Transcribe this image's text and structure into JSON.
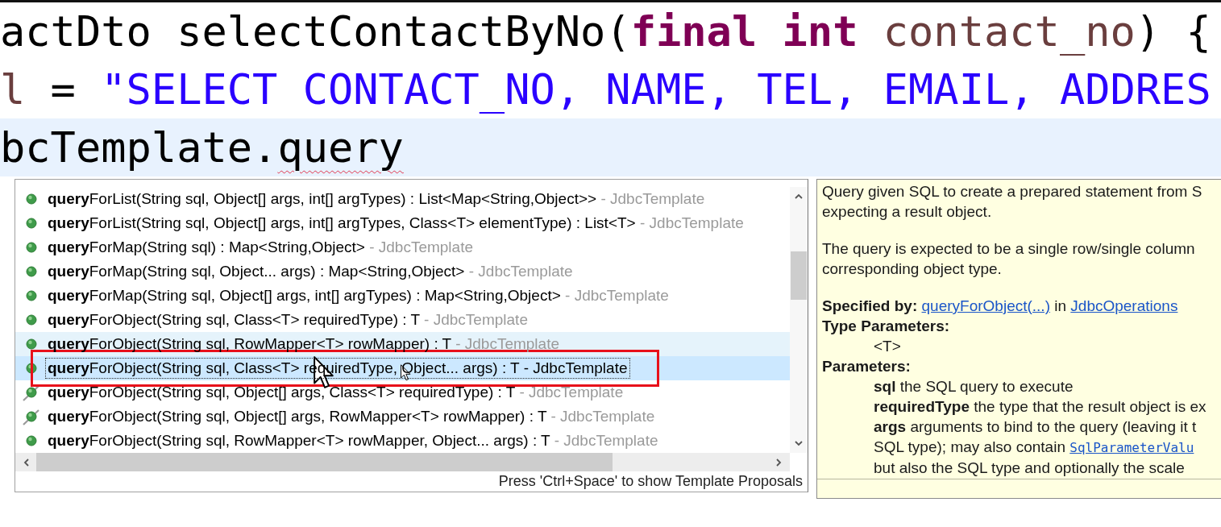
{
  "editor": {
    "lines": [
      {
        "current": false,
        "tokens": [
          {
            "text": "actDto selectContactByNo(",
            "kind": "plain"
          },
          {
            "text": "final int",
            "kind": "keyword"
          },
          {
            "text": " contact_no",
            "kind": "variable"
          },
          {
            "text": ") {",
            "kind": "plain"
          }
        ]
      },
      {
        "current": false,
        "tokens": [
          {
            "text": "l",
            "kind": "variable"
          },
          {
            "text": " = ",
            "kind": "plain"
          },
          {
            "text": "\"SELECT CONTACT_NO, NAME, TEL, EMAIL, ADDRES",
            "kind": "string"
          }
        ]
      },
      {
        "current": true,
        "tokens": [
          {
            "text": "bcTemplate.",
            "kind": "plain"
          },
          {
            "text": "query",
            "kind": "problem"
          }
        ]
      }
    ]
  },
  "completion": {
    "proposals": [
      {
        "match": "query",
        "rest": "ForList(String sql, Object[] args, int[] argTypes) : List<Map<String,Object>>",
        "source": "- JdbcTemplate",
        "deprecated": false,
        "hovered": false,
        "selected": false,
        "annotated": false
      },
      {
        "match": "query",
        "rest": "ForList(String sql, Object[] args, int[] argTypes, Class<T> elementType) : List<T>",
        "source": "- JdbcTemplate",
        "deprecated": false,
        "hovered": false,
        "selected": false,
        "annotated": false
      },
      {
        "match": "query",
        "rest": "ForMap(String sql) : Map<String,Object>",
        "source": "- JdbcTemplate",
        "deprecated": false,
        "hovered": false,
        "selected": false,
        "annotated": false
      },
      {
        "match": "query",
        "rest": "ForMap(String sql, Object... args) : Map<String,Object>",
        "source": "- JdbcTemplate",
        "deprecated": false,
        "hovered": false,
        "selected": false,
        "annotated": false
      },
      {
        "match": "query",
        "rest": "ForMap(String sql, Object[] args, int[] argTypes) : Map<String,Object>",
        "source": "- JdbcTemplate",
        "deprecated": false,
        "hovered": false,
        "selected": false,
        "annotated": false
      },
      {
        "match": "query",
        "rest": "ForObject(String sql, Class<T> requiredType) : T",
        "source": "- JdbcTemplate",
        "deprecated": false,
        "hovered": false,
        "selected": false,
        "annotated": false
      },
      {
        "match": "query",
        "rest": "ForObject(String sql, RowMapper<T> rowMapper) : T",
        "source": "- JdbcTemplate",
        "deprecated": false,
        "hovered": true,
        "selected": false,
        "annotated": false
      },
      {
        "match": "query",
        "rest": "ForObject(String sql, Class<T> requiredType, Object... args) : T",
        "source": "- JdbcTemplate",
        "deprecated": false,
        "hovered": false,
        "selected": true,
        "annotated": true
      },
      {
        "match": "query",
        "rest": "ForObject(String sql, Object[] args, Class<T> requiredType) : T",
        "source": "- JdbcTemplate",
        "deprecated": true,
        "hovered": false,
        "selected": false,
        "annotated": false
      },
      {
        "match": "query",
        "rest": "ForObject(String sql, Object[] args, RowMapper<T> rowMapper) : T",
        "source": "- JdbcTemplate",
        "deprecated": true,
        "hovered": false,
        "selected": false,
        "annotated": false
      },
      {
        "match": "query",
        "rest": "ForObject(String sql, RowMapper<T> rowMapper, Object... args) : T",
        "source": "- JdbcTemplate",
        "deprecated": false,
        "hovered": false,
        "selected": false,
        "annotated": false
      }
    ],
    "footer": "Press 'Ctrl+Space' to show Template Proposals"
  },
  "documentation": {
    "paragraphs": [
      {
        "lines": [
          {
            "kind": "text",
            "parts": [
              {
                "kind": "text",
                "text": "Query given SQL to create a prepared statement from S"
              }
            ]
          },
          {
            "kind": "text",
            "parts": [
              {
                "kind": "text",
                "text": "expecting a result object."
              }
            ]
          }
        ]
      },
      {
        "lines": [
          {
            "kind": "text",
            "parts": [
              {
                "kind": "text",
                "text": "The query is expected to be a single row/single column"
              }
            ]
          },
          {
            "kind": "text",
            "parts": [
              {
                "kind": "text",
                "text": "corresponding object type."
              }
            ]
          }
        ]
      },
      {
        "lines": [
          {
            "kind": "text",
            "parts": [
              {
                "kind": "text",
                "text": "**Specified by:** "
              },
              {
                "kind": "link",
                "text": "queryForObject(...)"
              },
              {
                "kind": "text",
                "text": " in "
              },
              {
                "kind": "link",
                "text": "JdbcOperations"
              }
            ]
          },
          {
            "kind": "heading",
            "parts": [
              {
                "kind": "text",
                "text": "Type Parameters:"
              }
            ]
          },
          {
            "kind": "indent",
            "parts": [
              {
                "kind": "text",
                "text": "<T>"
              }
            ]
          },
          {
            "kind": "heading",
            "parts": [
              {
                "kind": "text",
                "text": "Parameters:"
              }
            ]
          },
          {
            "kind": "indent",
            "parts": [
              {
                "kind": "text",
                "text": "**sql** the SQL query to execute"
              }
            ]
          },
          {
            "kind": "indent",
            "parts": [
              {
                "kind": "text",
                "text": "**requiredType** the type that the result object is ex"
              }
            ]
          },
          {
            "kind": "indent",
            "parts": [
              {
                "kind": "text",
                "text": "**args** arguments to bind to the query (leaving it t"
              }
            ]
          },
          {
            "kind": "indent",
            "parts": [
              {
                "kind": "text",
                "text": "SQL type); may also contain "
              },
              {
                "kind": "code_link",
                "text": "SqlParameterValu"
              }
            ]
          },
          {
            "kind": "indent",
            "parts": [
              {
                "kind": "text",
                "text": "but also the SQL type and optionally the scale"
              }
            ]
          }
        ]
      }
    ]
  }
}
